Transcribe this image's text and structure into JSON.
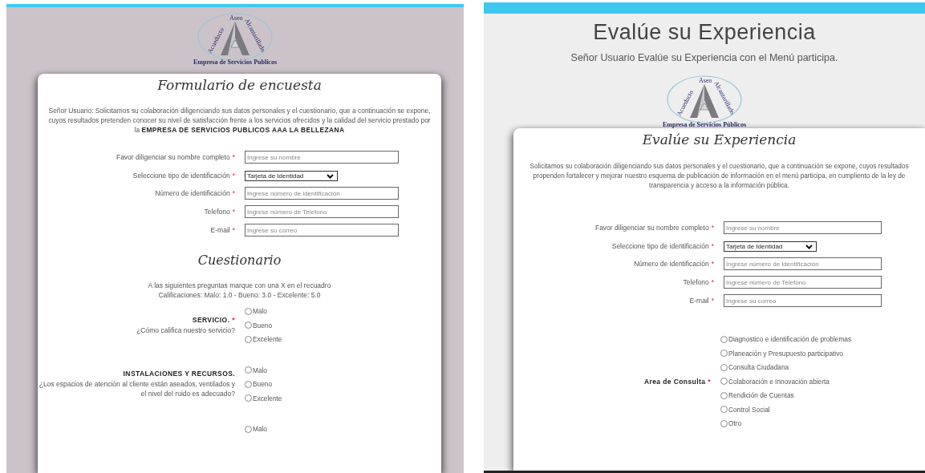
{
  "left_form": {
    "logo": {
      "ring_words": [
        "Acueducto",
        "Aseo",
        "Alcantarillado"
      ],
      "caption": "Empresa de Servicios Publicos"
    },
    "card": {
      "title": "Formulario de encuesta",
      "intro": "Señor Usuario: Solicitamos su colaboración diligenciando sus datos personales y el cuestionario, que a continuación se expone, cuyos resultados pretenden conocer su nivel de satisfacción frente a los servicios ofrecidos y la calidad del servicio prestado por la **EMPRESA DE SERVICIOS PUBLICOS AAA LA BELLEZANA**",
      "fields": [
        {
          "kind": "text",
          "label": "Favor diligenciar su nombre completo",
          "mark": "*",
          "placeholder": "Ingrese su nombre"
        },
        {
          "kind": "select",
          "label": "Seleccione tipo de identificación",
          "mark": "*",
          "value": "Tarjeta de Identidad"
        },
        {
          "kind": "text",
          "label": "Número de identificación",
          "mark": "*",
          "placeholder": "Ingrese número de identificación"
        },
        {
          "kind": "text",
          "label": "Telefono",
          "mark": "*",
          "placeholder": "Ingrese número de Telefono"
        },
        {
          "kind": "text",
          "label": "E-mail",
          "mark": "*",
          "placeholder": "Ingrese su correo"
        }
      ],
      "questionnaire": {
        "title": "Cuestionario",
        "instructions": [
          "A las siguientes preguntas marque con una X en el recuadro",
          "Calificaciones: Malo: 1.0 - Bueno: 3.0 - Excelente: 5.0"
        ],
        "questions": [
          {
            "title": "SERVICIO.",
            "mark": "*",
            "question": "¿Cómo califica nuestro servicio?",
            "options": [
              {
                "label": "Malo",
                "selected": false
              },
              {
                "label": "Bueno",
                "selected": false
              },
              {
                "label": "Excelente",
                "selected": false
              }
            ]
          },
          {
            "title": "INSTALACIONES Y RECURSOS.",
            "question": "¿Los espacios de atención al cliente están aseados, ventilados y el nivel del ruido es adecuado?",
            "options": [
              {
                "label": "Malo",
                "selected": false
              },
              {
                "label": "Bueno",
                "selected": false
              },
              {
                "label": "Excelente",
                "selected": false
              }
            ]
          },
          {
            "options": [
              {
                "label": "Malo",
                "selected": false
              }
            ]
          }
        ]
      }
    }
  },
  "right_form": {
    "header": {
      "title": "Evalúe su Experiencia",
      "subtitle": "Señor Usuario Evalúe su Experiencia con el Menú participa."
    },
    "logo": {
      "ring_words": [
        "Acueducto",
        "Aseo",
        "Alcantarillado"
      ],
      "caption": "Empresa de Servicios Públicos"
    },
    "card": {
      "title": "Evalúe su Experiencia",
      "intro": "Solicitamos su colaboración diligenciando sus datos personales y el cuestionario, que a continuación se expone, cuyos resultados propenden fortalecer y mejorar nuestro esquema de publicación de información en el menú participa, en cumpliento de la ley de transparencia y acceso a la información pública.",
      "fields": [
        {
          "kind": "text",
          "label": "Favor diligenciar su nombre completo",
          "mark": "*",
          "placeholder": "Ingrese su nombre"
        },
        {
          "kind": "select",
          "label": "Seleccione tipo de identificación",
          "mark": "*",
          "value": "Tarjeta de Identidad"
        },
        {
          "kind": "text",
          "label": "Número de identificación",
          "mark": "*",
          "placeholder": "Ingrese número de identificación"
        },
        {
          "kind": "text",
          "label": "Telefono",
          "mark": "*",
          "placeholder": "Ingrese número de Telefono"
        },
        {
          "kind": "text",
          "label": "E-mail",
          "mark": "*",
          "placeholder": "Ingrese su correo"
        }
      ],
      "choice_group": {
        "label": "Area de Consulta",
        "mark": "*",
        "options": [
          {
            "label": "Diagnostico e identificación de problemas",
            "selected": false
          },
          {
            "label": "Planeación y Presupuesto participativo",
            "selected": false
          },
          {
            "label": "Consulta Ciudadana",
            "selected": false
          },
          {
            "label": "Colaboración e Innovación abierta",
            "selected": false
          },
          {
            "label": "Rendición de Cuentas",
            "selected": false
          },
          {
            "label": "Control Social",
            "selected": false
          },
          {
            "label": "Otro",
            "selected": false
          }
        ]
      }
    }
  }
}
